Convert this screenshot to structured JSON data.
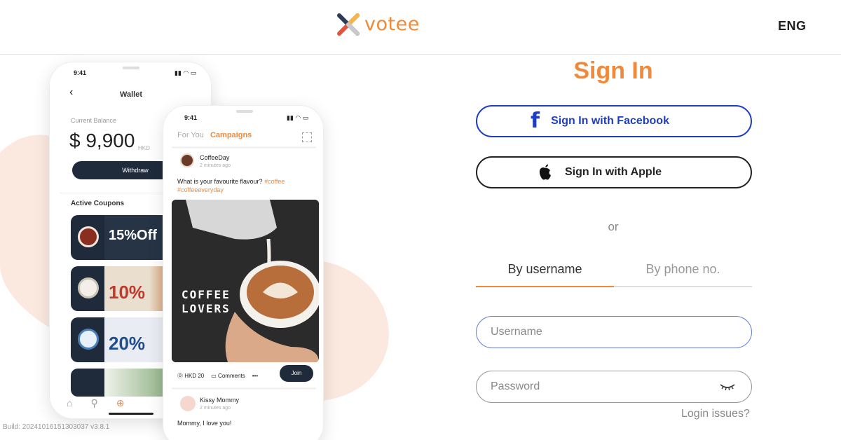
{
  "header": {
    "brand": "votee",
    "language": "ENG"
  },
  "hero": {
    "wallet_phone": {
      "status_time": "9:41",
      "title": "Wallet",
      "current_balance_label": "Current Balance",
      "balance": "$ 9,900",
      "currency": "HKD",
      "withdraw_label": "Withdraw",
      "active_coupons_label": "Active Coupons",
      "coupons": [
        {
          "offer": "15%Off"
        },
        {
          "offer": "10%"
        },
        {
          "offer": "20%"
        }
      ]
    },
    "feed_phone": {
      "status_time": "9:41",
      "tab_for_you": "For You",
      "tab_campaigns": "Campaigns",
      "post": {
        "author": "CoffeeDay",
        "time": "2 minutes ago",
        "text": "What is your favourite flavour?",
        "tags": "#coffee #coffeeeveryday",
        "image_caption_line1": "COFFEE",
        "image_caption_line2": "LOVERS",
        "price": "HKD 20",
        "comments_label": "Comments",
        "more": "•••",
        "join_label": "Join"
      },
      "post2": {
        "author": "Kissy Mommy",
        "time": "2 minutes ago",
        "text": "Mommy, I love you!"
      }
    }
  },
  "build": "Build: 20241016151303037 v3.8.1",
  "signin": {
    "title": "Sign In",
    "facebook_label": "Sign In with Facebook",
    "apple_label": "Sign In with Apple",
    "or_label": "or",
    "tab_username": "By username",
    "tab_phone": "By phone no.",
    "username_placeholder": "Username",
    "password_placeholder": "Password",
    "login_issues": "Login issues?"
  },
  "colors": {
    "accent": "#f08a3a",
    "facebook": "#1f3fbf",
    "dark": "#1f2b3a"
  }
}
